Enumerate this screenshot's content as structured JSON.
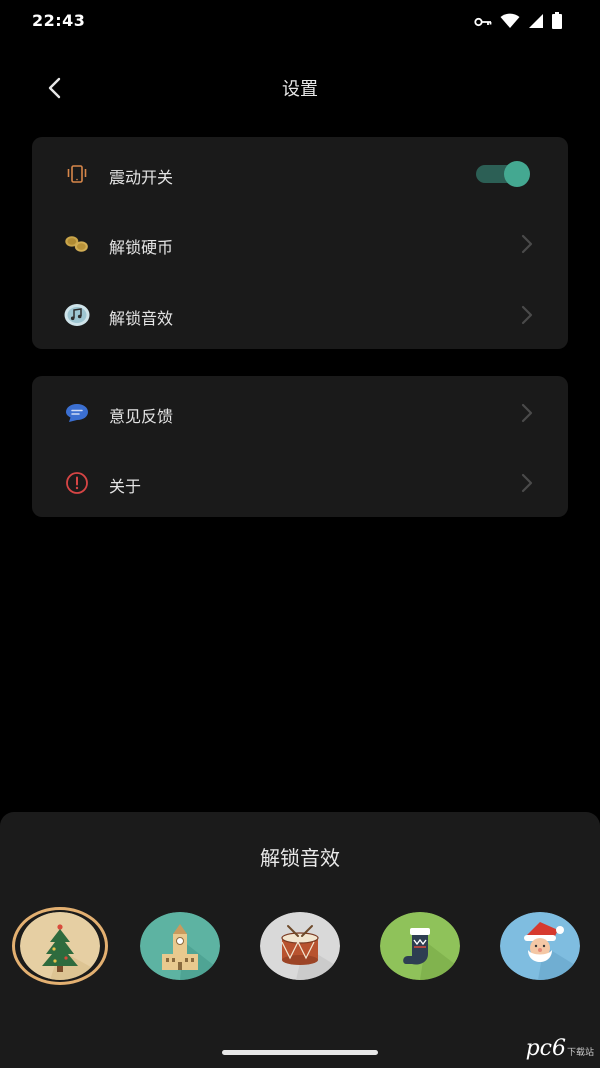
{
  "status_bar": {
    "time": "22:43",
    "icons": [
      "vpn-key-icon",
      "wifi-icon",
      "cellular-signal-icon",
      "battery-icon"
    ]
  },
  "header": {
    "title": "设置",
    "back_icon": "chevron-left-icon"
  },
  "settings": {
    "group1": [
      {
        "label": "震动开关",
        "icon": "vibration-phone-icon",
        "control": "toggle",
        "on": true
      },
      {
        "label": "解锁硬币",
        "icon": "coins-icon",
        "control": "chevron"
      },
      {
        "label": "解锁音效",
        "icon": "music-note-icon",
        "control": "chevron"
      }
    ],
    "group2": [
      {
        "label": "意见反馈",
        "icon": "chat-bubble-icon",
        "control": "chevron"
      },
      {
        "label": "关于",
        "icon": "info-alert-icon",
        "control": "chevron"
      }
    ]
  },
  "sheet": {
    "title": "解锁音效",
    "sounds": [
      {
        "icon": "christmas-tree-icon",
        "selected": true
      },
      {
        "icon": "clock-tower-icon",
        "selected": false
      },
      {
        "icon": "drum-icon",
        "selected": false
      },
      {
        "icon": "christmas-stocking-icon",
        "selected": false
      },
      {
        "icon": "santa-claus-icon",
        "selected": false
      }
    ]
  },
  "watermark": {
    "text_main": "pc6",
    "text_sub": "下载站"
  },
  "colors": {
    "background": "#000000",
    "card": "#1a1a1a",
    "toggle_on": "#44a891",
    "selected_ring": "#e3b071"
  }
}
